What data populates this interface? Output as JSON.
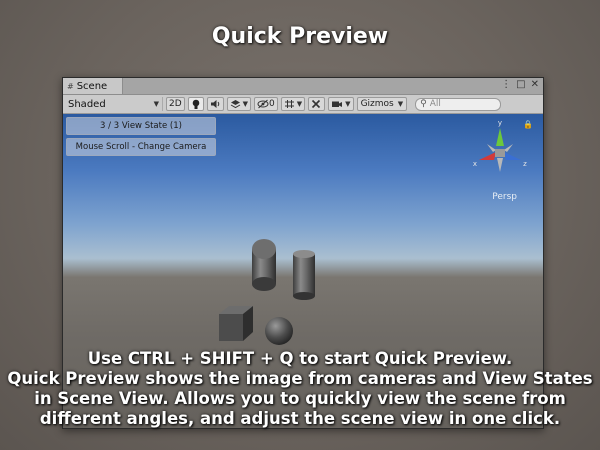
{
  "title": "Quick Preview",
  "window": {
    "tab_label": "Scene",
    "shading_mode": "Shaded",
    "toolbar": {
      "btn_2d": "2D",
      "hidden_count": "0",
      "gizmos_label": "Gizmos",
      "search_placeholder": "All"
    },
    "overlay": {
      "view_state": "3 / 3 View State (1)",
      "mouse_hint": "Mouse Scroll - Change Camera"
    },
    "gizmo": {
      "axes": [
        "y",
        "x",
        "z"
      ],
      "projection": "Persp"
    }
  },
  "caption": [
    "Use CTRL + SHIFT + Q to start Quick Preview.",
    "Quick Preview shows the image from cameras and View States",
    "in Scene View. Allows you to quickly view the scene from",
    "different angles, and adjust the scene view in one click."
  ]
}
